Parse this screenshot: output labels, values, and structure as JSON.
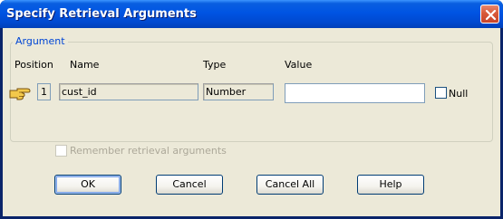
{
  "window": {
    "title": "Specify Retrieval Arguments",
    "titlebar_color": "#0054e3",
    "close_button_color": "#d85a3a"
  },
  "argument_group": {
    "label": "Argument",
    "headers": {
      "position": "Position",
      "name": "Name",
      "type": "Type",
      "value": "Value"
    },
    "rows": [
      {
        "indicator_icon": "pointing-hand-icon",
        "position": "1",
        "name": "cust_id",
        "type": "Number",
        "value": "",
        "null_label": "Null",
        "null_checked": false
      }
    ]
  },
  "remember": {
    "label": "Remember retrieval arguments",
    "checked": false,
    "enabled": false
  },
  "buttons": {
    "ok": "OK",
    "cancel": "Cancel",
    "cancel_all": "Cancel All",
    "help": "Help"
  }
}
